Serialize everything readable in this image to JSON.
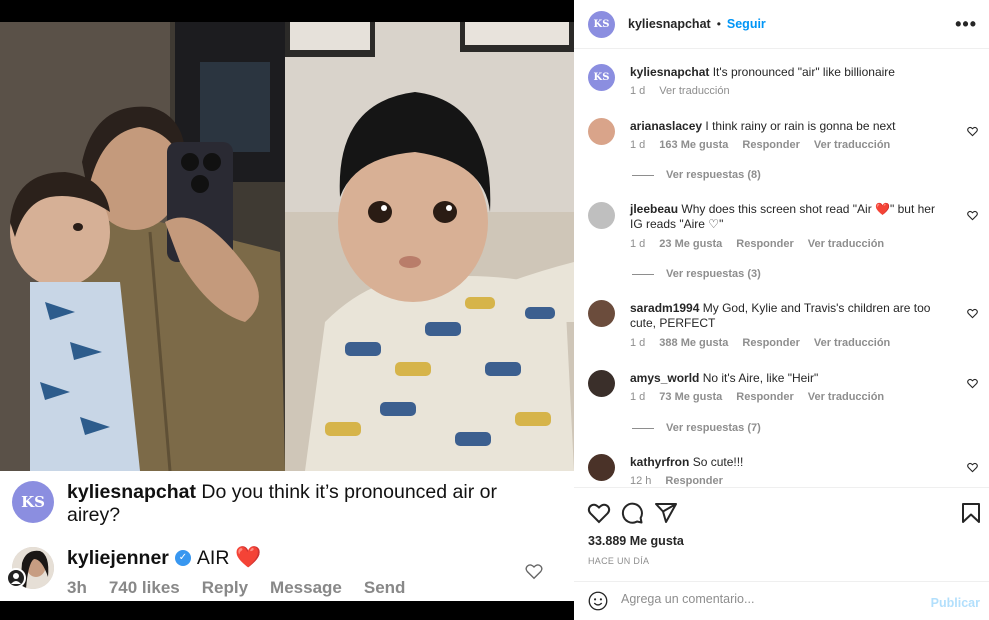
{
  "screenshot": {
    "avatar_text": "KS",
    "caption_user": "kyliesnapchat",
    "caption_text": " Do you think it’s pronounced air or airey?",
    "comment_user": "kyliejenner",
    "comment_text": "AIR",
    "comment_emoji": "❤️",
    "actions": [
      "3h",
      "740 likes",
      "Reply",
      "Message",
      "Send"
    ]
  },
  "header": {
    "avatar_text": "KS",
    "username": "kyliesnapchat",
    "separator": "•",
    "follow": "Seguir",
    "more": "•••"
  },
  "caption": {
    "username": "kyliesnapchat",
    "text": "It's pronounced \"air\" like billionaire",
    "time": "1 d",
    "translate": "Ver traducción"
  },
  "comments": [
    {
      "user": "arianaslacey",
      "text": "I think rainy or rain is gonna be next",
      "time": "1 d",
      "likes": "163 Me gusta",
      "reply": "Responder",
      "translate": "Ver traducción",
      "replies": "Ver respuestas (8)"
    },
    {
      "user": "jleebeau",
      "text_a": "Why does this screen shot read \"Air ",
      "heart": "❤️",
      "text_b": "\" but her IG reads \"Aire ",
      "heart2": "♡",
      "text_c": "\"",
      "time": "1 d",
      "likes": "23 Me gusta",
      "reply": "Responder",
      "translate": "Ver traducción",
      "replies": "Ver respuestas (3)"
    },
    {
      "user": "saradm1994",
      "text": "My God, Kylie and Travis's children are too cute, PERFECT",
      "time": "1 d",
      "likes": "388 Me gusta",
      "reply": "Responder",
      "translate": "Ver traducción"
    },
    {
      "user": "amys_world",
      "text": "No it's Aire, like \"Heir\"",
      "time": "1 d",
      "likes": "73 Me gusta",
      "reply": "Responder",
      "translate": "Ver traducción",
      "replies": "Ver respuestas (7)"
    },
    {
      "user": "kathyrfron",
      "text": "So cute!!!",
      "time": "12 h",
      "reply": "Responder"
    }
  ],
  "stats": {
    "likes": "33.889 Me gusta",
    "time_ago": "HACE UN DÍA"
  },
  "composer": {
    "placeholder": "Agrega un comentario...",
    "post": "Publicar"
  },
  "icons": {
    "like": "heart-icon",
    "comment": "comment-icon",
    "share": "send-icon",
    "save": "bookmark-icon",
    "emoji": "emoji-icon"
  },
  "colors": {
    "link": "#0095f6",
    "post_disabled": "#b2dffc",
    "heart_red": "#ed4956",
    "avatar_ks": "#8b8ee0"
  }
}
